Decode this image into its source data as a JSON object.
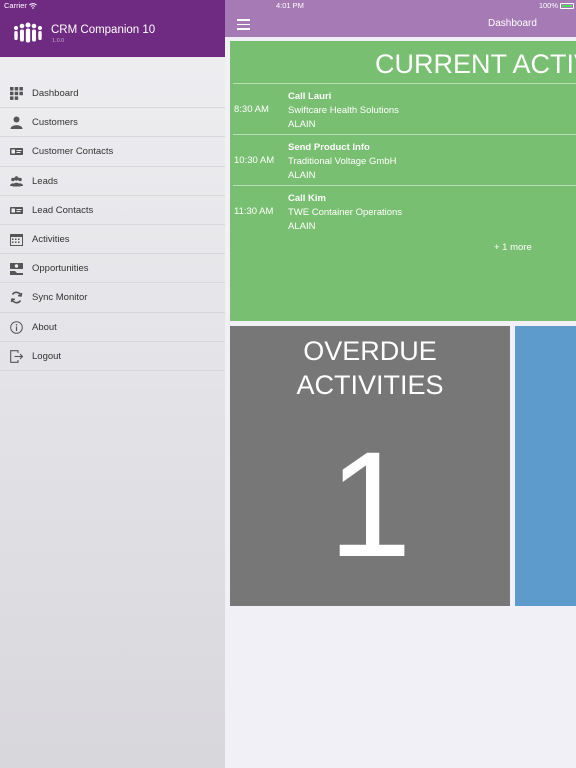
{
  "status_bar": {
    "carrier": "Carrier",
    "time": "4:01 PM",
    "battery": "100%"
  },
  "sidebar": {
    "app_title": "CRM Companion 10",
    "app_version": "1.0.0",
    "brand_color": "#6f2a82",
    "items": [
      {
        "label": "Dashboard",
        "icon": "grid-icon"
      },
      {
        "label": "Customers",
        "icon": "person-icon"
      },
      {
        "label": "Customer Contacts",
        "icon": "contact-card-icon"
      },
      {
        "label": "Leads",
        "icon": "group-icon"
      },
      {
        "label": "Lead Contacts",
        "icon": "contact-card-icon"
      },
      {
        "label": "Activities",
        "icon": "calendar-icon"
      },
      {
        "label": "Opportunities",
        "icon": "money-icon"
      },
      {
        "label": "Sync Monitor",
        "icon": "sync-icon"
      },
      {
        "label": "About",
        "icon": "info-icon"
      },
      {
        "label": "Logout",
        "icon": "logout-icon"
      }
    ]
  },
  "topbar": {
    "title": "Dashboard",
    "color": "#a57ab5"
  },
  "current_activities": {
    "title": "CURRENT ACTIVITIES",
    "color": "#79bf71",
    "items": [
      {
        "time": "8:30 AM",
        "title": "Call Lauri",
        "company": "Swiftcare Health Solutions",
        "user": "ALAIN"
      },
      {
        "time": "10:30 AM",
        "title": "Send Product Info",
        "company": "Traditional Voltage GmbH",
        "user": "ALAIN"
      },
      {
        "time": "11:30 AM",
        "title": "Call Kim",
        "company": "TWE Container Operations",
        "user": "ALAIN"
      }
    ],
    "more": "+ 1 more"
  },
  "overdue_activities": {
    "title_line1": "OVERDUE",
    "title_line2": "ACTIVITIES",
    "count": "1",
    "color": "#777777"
  }
}
